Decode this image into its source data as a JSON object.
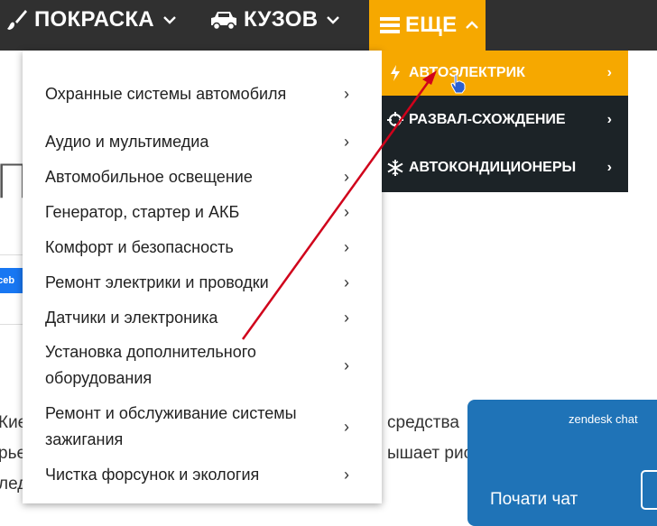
{
  "nav": {
    "items": [
      {
        "label": "ПОКРАСКА",
        "icon": "paint-brush-icon"
      },
      {
        "label": "КУЗОВ",
        "icon": "car-icon"
      },
      {
        "label": "ЕЩЕ",
        "icon": "menu-icon"
      }
    ]
  },
  "dropdown": {
    "items": [
      {
        "label": "Охранные системы автомобиля"
      },
      {
        "label": "Аудио и мультимедиа"
      },
      {
        "label": "Автомобильное освещение"
      },
      {
        "label": "Генератор, стартер и АКБ"
      },
      {
        "label": "Комфорт и безопасность"
      },
      {
        "label": "Ремонт электрики и проводки"
      },
      {
        "label": "Датчики и электроника"
      },
      {
        "label": "Установка дополнительного оборудования"
      },
      {
        "label": "Ремонт и обслуживание системы зажигания"
      },
      {
        "label": "Чистка форсунок и экология"
      }
    ]
  },
  "submenu": {
    "items": [
      {
        "label": "АВТОЭЛЕКТРИК",
        "icon": "lightning-icon"
      },
      {
        "label": "РАЗВАЛ-СХОЖДЕНИЕ",
        "icon": "wheel-alignment-icon"
      },
      {
        "label": "АВТОКОНДИЦИОНЕРЫ",
        "icon": "snowflake-icon"
      }
    ]
  },
  "background": {
    "big_letter": "П",
    "fb_label": "aceb",
    "line1_left": "Кие",
    "line1_right": "средства",
    "line2_left": "рье",
    "line2_right": "ышает рис",
    "line3_left": "лед"
  },
  "zendesk": {
    "title": "zendesk chat",
    "cta": "Почати чат"
  },
  "colors": {
    "nav_bg": "#303030",
    "accent": "#f6a800",
    "submenu_bg": "#1c2327",
    "zendesk": "#1f73b7",
    "annotation_arrow": "#d0021b"
  }
}
